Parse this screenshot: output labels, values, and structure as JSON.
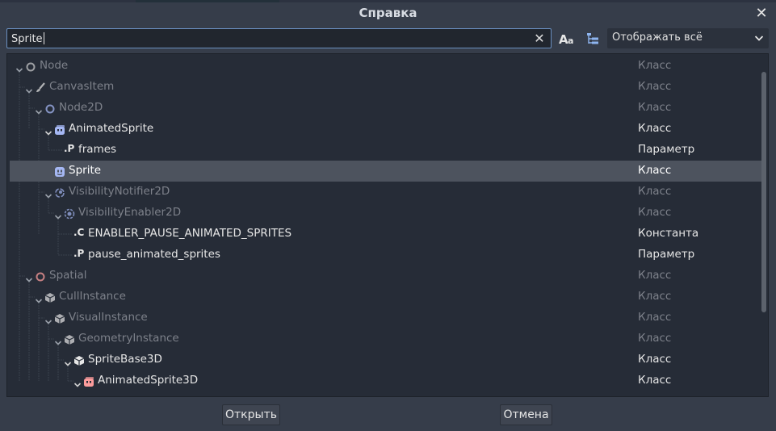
{
  "dialog": {
    "title": "Справка",
    "close_glyph": "✕"
  },
  "search": {
    "value": "Sprite",
    "clear_glyph": "✕"
  },
  "toolbar": {
    "case_sensitive_icon": "case-sensitive-icon",
    "hierarchy_icon": "hierarchy-icon",
    "filter": {
      "selected": "Отображать всё"
    }
  },
  "colors": {
    "accent": "#6a8fc0",
    "dim_text": "#7d818a",
    "bright_text": "#e6e6e6",
    "node_icon": "#e0e0e0",
    "node2d_icon": "#a5b7f3",
    "spatial_icon": "#fc9c9c"
  },
  "tree": {
    "rows": [
      {
        "name": "Node",
        "type": "Класс",
        "dim": true,
        "icon": "node-circle-icon"
      },
      {
        "name": "CanvasItem",
        "type": "Класс",
        "dim": true,
        "icon": "canvas-item-brush-icon"
      },
      {
        "name": "Node2D",
        "type": "Класс",
        "dim": true,
        "icon": "node2d-circle-icon"
      },
      {
        "name": "AnimatedSprite",
        "type": "Класс",
        "dim": false,
        "icon": "animated-sprite-icon"
      },
      {
        "name": "frames",
        "type": "Параметр",
        "dim": false,
        "icon": "property-icon",
        "prefix": ".P"
      },
      {
        "name": "Sprite",
        "type": "Класс",
        "dim": false,
        "icon": "sprite-icon",
        "selected": true
      },
      {
        "name": "VisibilityNotifier2D",
        "type": "Класс",
        "dim": true,
        "icon": "visibility-notifier-icon"
      },
      {
        "name": "VisibilityEnabler2D",
        "type": "Класс",
        "dim": true,
        "icon": "visibility-enabler-icon"
      },
      {
        "name": "ENABLER_PAUSE_ANIMATED_SPRITES",
        "type": "Константа",
        "dim": false,
        "icon": "constant-icon",
        "prefix": ".C"
      },
      {
        "name": "pause_animated_sprites",
        "type": "Параметр",
        "dim": false,
        "icon": "property-icon",
        "prefix": ".P"
      },
      {
        "name": "Spatial",
        "type": "Класс",
        "dim": true,
        "icon": "spatial-circle-icon"
      },
      {
        "name": "CullInstance",
        "type": "Класс",
        "dim": true,
        "icon": "cube-icon"
      },
      {
        "name": "VisualInstance",
        "type": "Класс",
        "dim": true,
        "icon": "cube-icon"
      },
      {
        "name": "GeometryInstance",
        "type": "Класс",
        "dim": true,
        "icon": "cube-icon"
      },
      {
        "name": "SpriteBase3D",
        "type": "Класс",
        "dim": false,
        "icon": "cube-icon"
      },
      {
        "name": "AnimatedSprite3D",
        "type": "Класс",
        "dim": false,
        "icon": "animated-sprite-3d-icon"
      }
    ]
  },
  "buttons": {
    "open": "Открыть",
    "cancel": "Отмена"
  }
}
